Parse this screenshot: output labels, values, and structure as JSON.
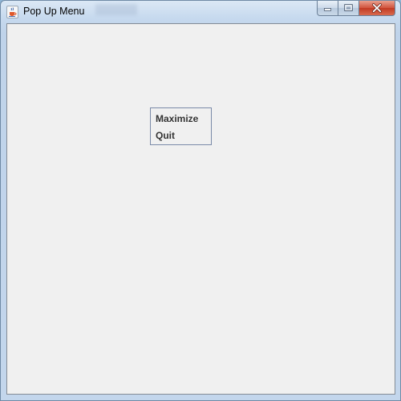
{
  "window": {
    "title": "Pop Up Menu",
    "app_icon": "java-coffee-cup-icon",
    "caption_buttons": {
      "minimize": "minimize-icon",
      "maximize": "maximize-icon",
      "close": "close-icon"
    }
  },
  "popup_menu": {
    "items": [
      {
        "label": "Maximize"
      },
      {
        "label": "Quit"
      }
    ]
  },
  "colors": {
    "client_background": "#f0f0f0",
    "menu_border": "#7a8aa8",
    "menu_text": "#333333",
    "close_button": "#c23a22"
  }
}
